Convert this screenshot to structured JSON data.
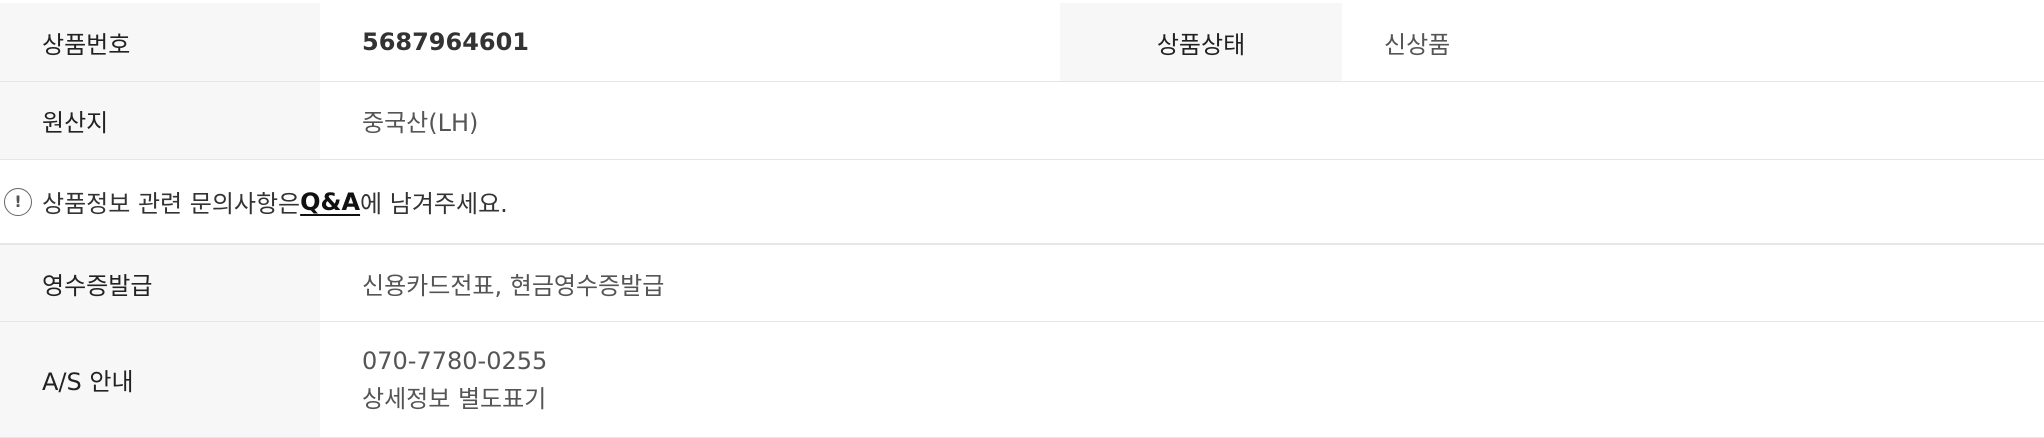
{
  "product_info": {
    "rows": [
      {
        "label1": "상품번호",
        "value1": "5687964601",
        "label2": "상품상태",
        "value2": "신상품"
      },
      {
        "label": "원산지",
        "value": "중국산(LH)"
      }
    ],
    "notice": {
      "icon": "exclamation-circle-icon",
      "prefix": "상품정보 관련 문의사항은 ",
      "link": "Q&A",
      "suffix": "에 남겨주세요."
    },
    "extra_rows": [
      {
        "label": "영수증발급",
        "value": "신용카드전표, 현금영수증발급"
      },
      {
        "label": "A/S 안내",
        "value_line1": "070-7780-0255",
        "value_line2": "상세정보 별도표기"
      }
    ]
  }
}
